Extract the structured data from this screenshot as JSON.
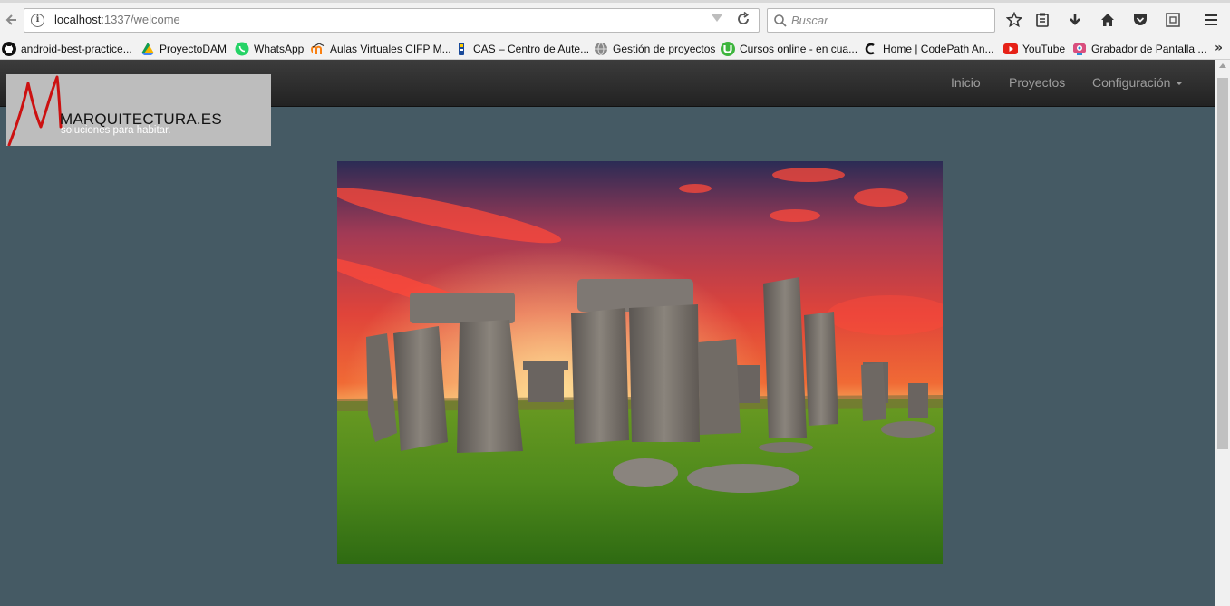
{
  "browser": {
    "url_host": "localhost",
    "url_rest": ":1337/welcome",
    "search_placeholder": "Buscar",
    "bookmarks": [
      {
        "label": "android-best-practice...",
        "icon": "github-icon"
      },
      {
        "label": "ProyectoDAM",
        "icon": "drive-icon"
      },
      {
        "label": "WhatsApp",
        "icon": "whatsapp-icon"
      },
      {
        "label": "Aulas Virtuales CIFP M...",
        "icon": "moodle-icon"
      },
      {
        "label": "CAS – Centro de Aute...",
        "icon": "cas-icon"
      },
      {
        "label": "Gestión de proyectos",
        "icon": "globe-icon"
      },
      {
        "label": "Cursos online - en cua...",
        "icon": "udemy-icon"
      },
      {
        "label": "Home | CodePath An...",
        "icon": "codepath-icon"
      },
      {
        "label": "YouTube",
        "icon": "youtube-icon"
      },
      {
        "label": "Grabador de Pantalla ...",
        "icon": "recorder-icon"
      }
    ],
    "bookmarks_more": "»"
  },
  "site": {
    "logo_name": "MARQUITECTURA.ES",
    "logo_tagline": "soluciones para habitar.",
    "nav": {
      "inicio": "Inicio",
      "proyectos": "Proyectos",
      "configuracion": "Configuración"
    },
    "hero_alt": "Stonehenge"
  },
  "colors": {
    "page_bg": "#455a64",
    "navbar_bg": "#222222",
    "logo_bg": "#bdbdbd",
    "logo_accent": "#cc1111"
  }
}
